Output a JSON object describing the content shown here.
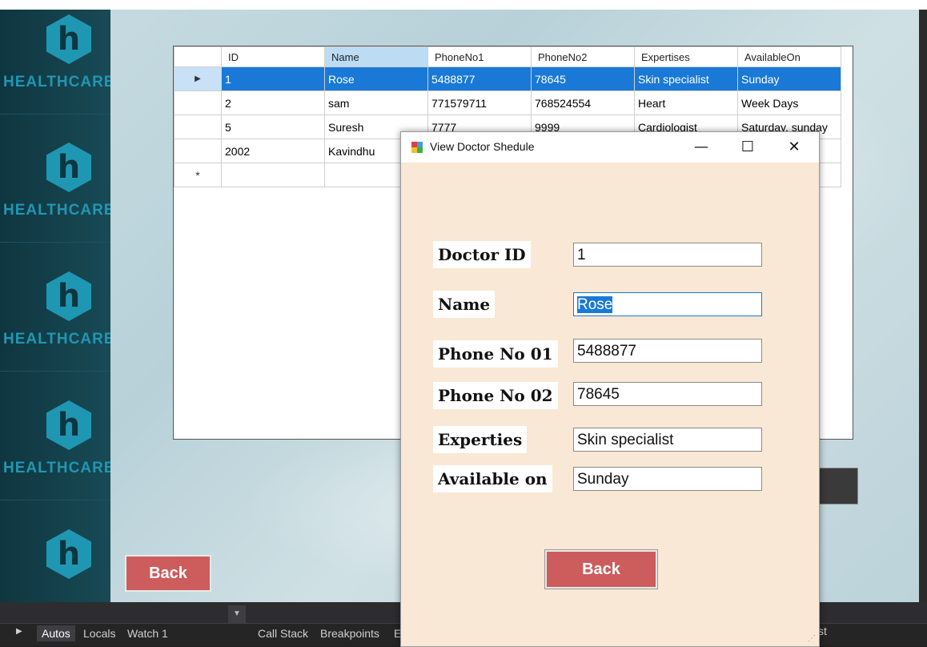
{
  "grid": {
    "columns": [
      "ID",
      "Name",
      "PhoneNo1",
      "PhoneNo2",
      "Expertises",
      "AvailableOn"
    ],
    "rows": [
      {
        "id": "1",
        "name": "Rose",
        "phone1": "5488877",
        "phone2": "78645",
        "expertise": "Skin specialist",
        "available": "Sunday"
      },
      {
        "id": "2",
        "name": "sam",
        "phone1": "771579711",
        "phone2": "768524554",
        "expertise": "Heart",
        "available": "Week Days"
      },
      {
        "id": "5",
        "name": "Suresh",
        "phone1": "7777",
        "phone2": "9999",
        "expertise": "Cardiologist",
        "available": "Saturday, sunday"
      },
      {
        "id": "2002",
        "name": "Kavindhu",
        "phone1": "",
        "phone2": "",
        "expertise": "",
        "available": ""
      }
    ],
    "current_row_marker": "▶",
    "new_row_marker": "*"
  },
  "sidebar": {
    "logo_letter": "h",
    "logo_text": "HEALTHCARE"
  },
  "main": {
    "back_label": "Back"
  },
  "dialog": {
    "title": "View Doctor Shedule",
    "fields": [
      {
        "label": "Doctor ID",
        "value": "1"
      },
      {
        "label": "Name",
        "value": "Rose"
      },
      {
        "label": "Phone No 01",
        "value": "5488877"
      },
      {
        "label": "Phone No 02",
        "value": "78645"
      },
      {
        "label": "Experties",
        "value": "Skin specialist"
      },
      {
        "label": "Available on",
        "value": "Sunday"
      }
    ],
    "back_label": "Back",
    "minimize_glyph": "—",
    "maximize_glyph": "☐",
    "close_glyph": "✕"
  },
  "vs": {
    "tabs": [
      "Autos",
      "Locals",
      "Watch 1",
      "Call Stack",
      "Breakpoints",
      "E"
    ],
    "peek_text": "st"
  },
  "colors": {
    "accent": "#1a79d6",
    "button": "#cd5c5c",
    "dialog_bg": "#f9e8d6",
    "sidebar": "#0f3640",
    "logo": "#1f97b3"
  }
}
